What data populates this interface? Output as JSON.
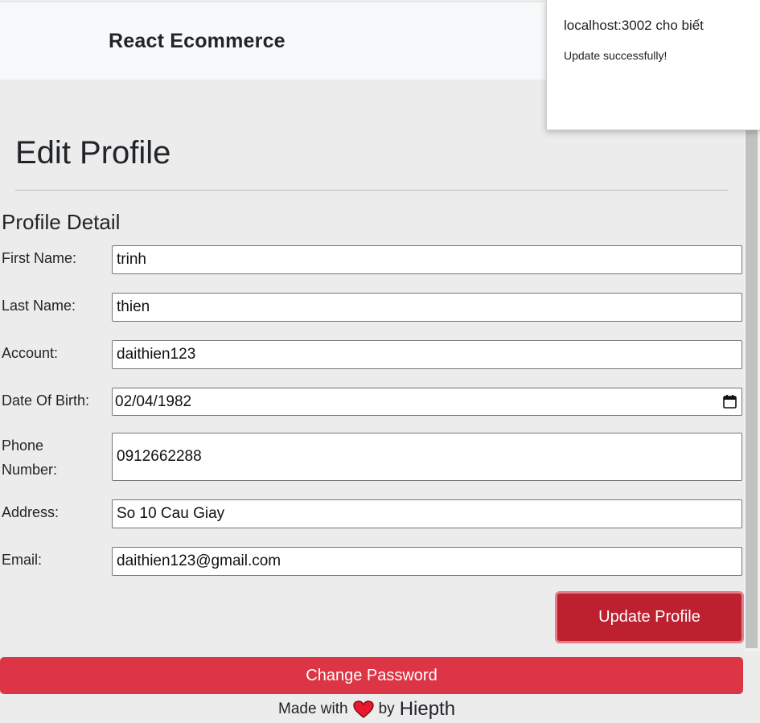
{
  "navbar": {
    "brand": "React Ecommerce"
  },
  "dialog": {
    "title": "localhost:3002 cho biết",
    "message": "Update successfully!"
  },
  "page": {
    "title": "Edit Profile",
    "section_title": "Profile Detail"
  },
  "form": {
    "first_name": {
      "label": "First Name:",
      "value": "trinh"
    },
    "last_name": {
      "label": "Last Name:",
      "value": "thien"
    },
    "account": {
      "label": "Account:",
      "value": "daithien123"
    },
    "dob": {
      "label": "Date Of Birth:",
      "value": "02/04/1982"
    },
    "phone": {
      "label_line1": "Phone",
      "label_line2": "Number:",
      "value": "0912662288"
    },
    "address": {
      "label": "Address:",
      "value": "So 10 Cau Giay"
    },
    "email": {
      "label": "Email:",
      "value": "daithien123@gmail.com"
    }
  },
  "buttons": {
    "update": "Update Profile",
    "change_password": "Change Password"
  },
  "footer": {
    "made_with": "Made with",
    "by": "by",
    "author": "Hiepth"
  },
  "colors": {
    "danger": "#dc3545",
    "danger_active": "#bd2130",
    "heart": "#e8192c"
  },
  "icons": {
    "calendar": "calendar-icon",
    "heart": "heart-icon"
  }
}
